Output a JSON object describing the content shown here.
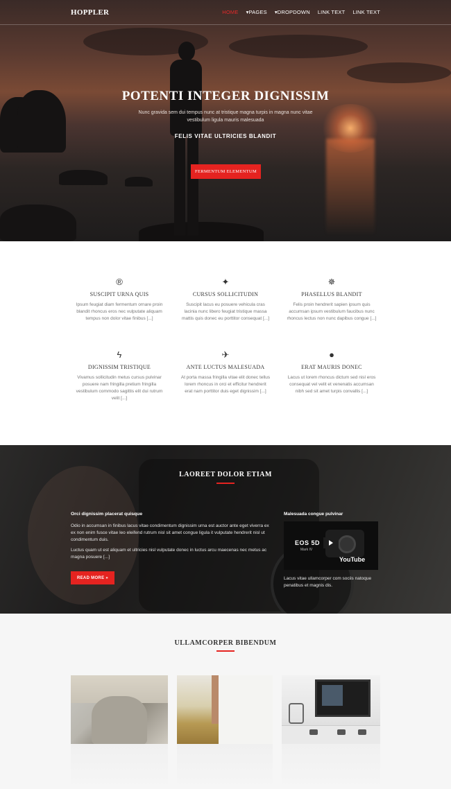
{
  "nav": {
    "brand": "HOPPLER",
    "items": [
      {
        "label": "HOME",
        "active": true
      },
      {
        "label": "▾PAGES"
      },
      {
        "label": "▾DROPDOWN"
      },
      {
        "label": "LINK TEXT"
      },
      {
        "label": "LINK TEXT"
      }
    ]
  },
  "hero": {
    "title": "POTENTI INTEGER DIGNISSIM",
    "subtitle": "Nunc gravida sem dui tempus nunc at tristique magna turpis in magna nunc vitae vestibulum ligula mauris malesuada",
    "tagline": "FELIS VITAE ULTRICIES BLANDIT",
    "button": "FERMENTUM ELEMENTUM"
  },
  "features": [
    {
      "icon": "registered-icon",
      "glyph": "®",
      "title": "SUSCIPIT URNA QUIS",
      "text": "Ipsum feugiat diam fermentum ornare proin blandit rhoncus eros nec vulputate aliquam tempus non dolor vitae finibus [...]"
    },
    {
      "icon": "rebel-icon",
      "glyph": "✦",
      "title": "CURSUS SOLLICITUDIN",
      "text": "Suscipit lacus eu posuere vehicula cras lacinia nunc libero feugiat tristique massa mattis quis donec eu porttitor consequat [...]"
    },
    {
      "icon": "empire-icon",
      "glyph": "✵",
      "title": "PHASELLUS BLANDIT",
      "text": "Felis proin hendrerit sapien ipsum quis accumsan ipsum vestibulum faucibus nunc rhoncus lectus non nunc dapibus congue [...]"
    },
    {
      "icon": "bolt-icon",
      "glyph": "ϟ",
      "title": "DIGNISSIM TRISTIQUE",
      "text": "Vivamus sollicitudin metus cursus pulvinar posuere nam fringilla pretium fringilla vestibulum commodo sagittis elit dui rutrum velit [...]"
    },
    {
      "icon": "fighter-jet-icon",
      "glyph": "✈",
      "title": "ANTE LUCTUS MALESUADA",
      "text": "At porta massa fringilla vitae elit donec tellus lorem rhoncus in orci et efficitur hendrerit erat nam porttitor duis eget dignissim [...]"
    },
    {
      "icon": "globe-icon",
      "glyph": "●",
      "title": "ERAT MAURIS DONEC",
      "text": "Lacus ut lorem rhoncus dictum sed nisl eros consequat vel velit et venenatis accumsan nibh sed sit amet turpis convallis [...]"
    }
  ],
  "dark": {
    "title": "LAOREET DOLOR ETIAM",
    "heading": "Orci dignissim placerat quisque",
    "para1": "Odio in accumsan in finibus lacus vitae condimentum dignissim urna est auctor ante eget viverra ex ex non enim fusce vitae leo eleifend rutrum nisl sit amet congue ligula it vulputate hendrerit nisl ut condimentum duis.",
    "para2": "Luctus quam ut est aliquam et ultricies nisl vulputate donec in luctus arcu maecenas nec metus ac magna posuere [...]",
    "button": "READ MORE »",
    "side_heading": "Malesuada congue pulvinar",
    "video_brand": "EOS 5D",
    "video_model": "Mark IV",
    "video_provider": "YouTube",
    "side_text": "Lacus vitae ullamcorper com sociis natoque penatibus et magnis dis."
  },
  "bottom": {
    "title": "ULLAMCORPER BIBENDUM"
  },
  "colors": {
    "accent": "#e52320",
    "dark_bg": "#1c1b1b"
  }
}
